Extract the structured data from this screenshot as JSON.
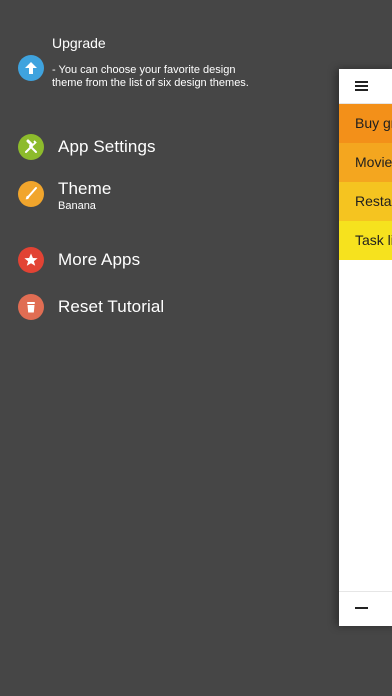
{
  "menu": {
    "upgrade": {
      "title": "Upgrade",
      "description": "- You can choose your favorite design theme from the list of six design themes.",
      "icon": "arrow-up-icon",
      "color": "#3fa3de"
    },
    "app_settings": {
      "label": "App Settings",
      "icon": "tools-icon",
      "color": "#8dbb2c"
    },
    "theme": {
      "label": "Theme",
      "sublabel": "Banana",
      "icon": "brush-icon",
      "color": "#f1a52c"
    },
    "more_apps": {
      "label": "More Apps",
      "icon": "star-icon",
      "color": "#e24334"
    },
    "reset_tutorial": {
      "label": "Reset Tutorial",
      "icon": "trash-icon",
      "color": "#e06d53"
    }
  },
  "panel": {
    "menu_icon": "hamburger-icon",
    "add_icon": "minus-icon",
    "items": [
      {
        "label": "Buy gr",
        "color": "#f39019"
      },
      {
        "label": "Movie",
        "color": "#f4a61f"
      },
      {
        "label": "Restau",
        "color": "#f5c420"
      },
      {
        "label": "Task li",
        "color": "#f6e21e"
      }
    ]
  }
}
